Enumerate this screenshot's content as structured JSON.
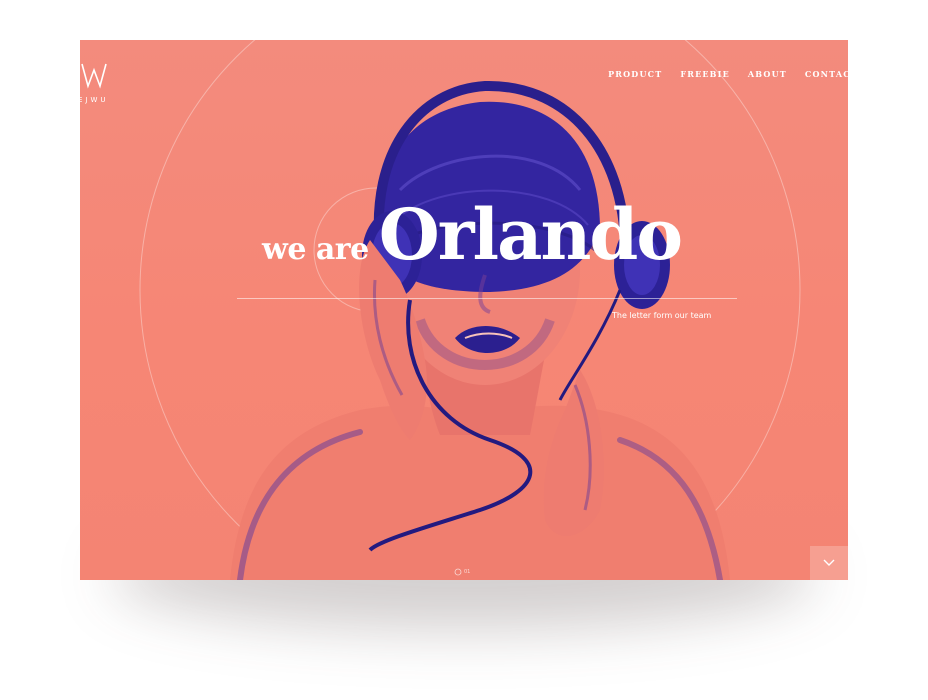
{
  "site": {
    "logo_text": "EJWU"
  },
  "nav": {
    "items": [
      {
        "label": "PRODUCT"
      },
      {
        "label": "FREEBIE"
      },
      {
        "label": "ABOUT"
      },
      {
        "label": "CONTACT"
      }
    ]
  },
  "hero": {
    "prefix": "we are",
    "name": "Orlando",
    "tagline": "The letter form our team",
    "slide_label": "01"
  },
  "colors": {
    "background": "#f68675",
    "duotone_dark": "#3a2aa0",
    "text": "#ffffff"
  },
  "icons": {
    "scroll": "chevron-down-icon",
    "slide": "circle-icon"
  }
}
